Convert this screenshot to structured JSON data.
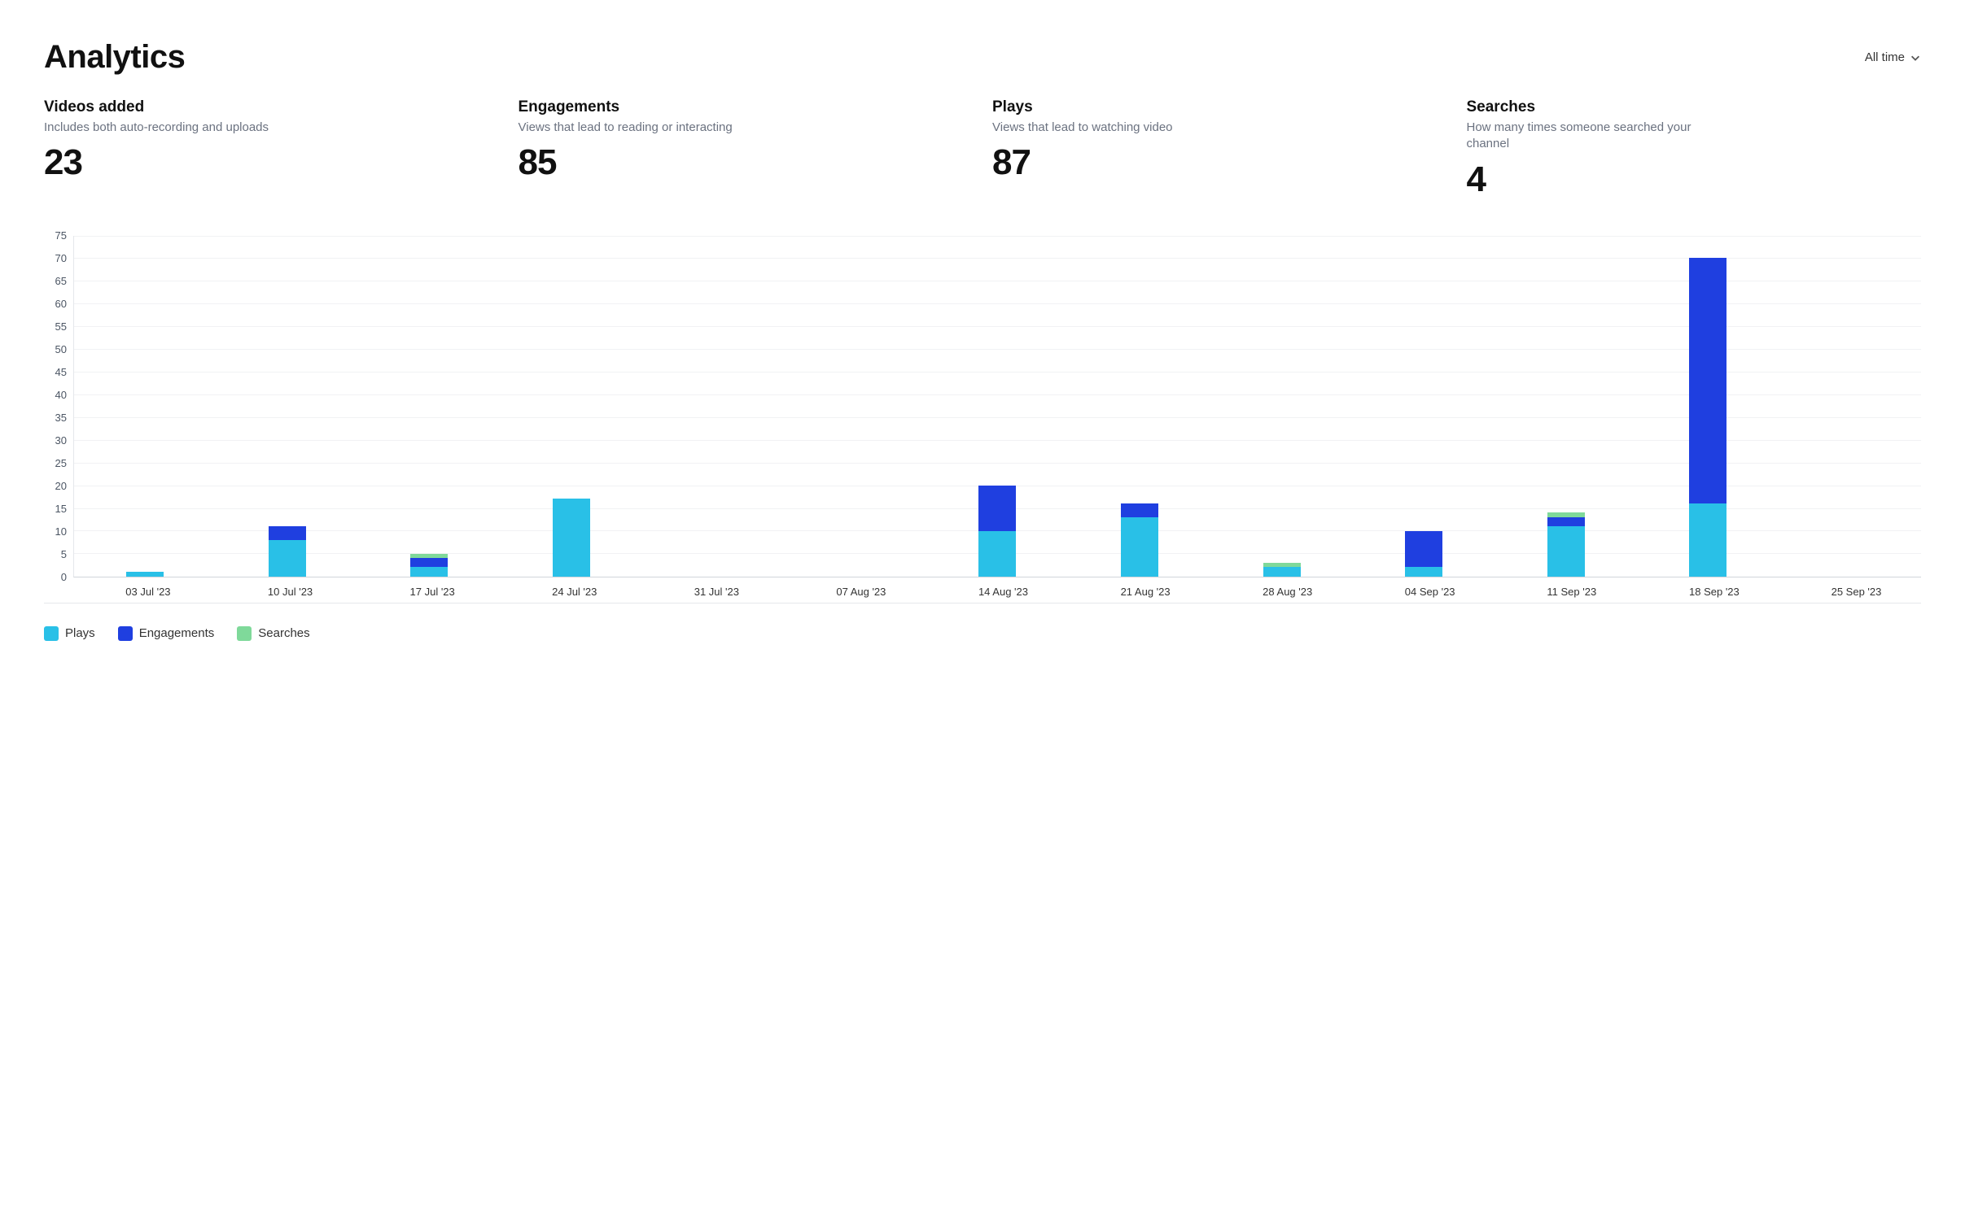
{
  "header": {
    "title": "Analytics",
    "time_range_label": "All time"
  },
  "stats": [
    {
      "title": "Videos added",
      "subtitle": "Includes both auto-recording and uploads",
      "value": "23"
    },
    {
      "title": "Engagements",
      "subtitle": "Views that lead to reading or interacting",
      "value": "85"
    },
    {
      "title": "Plays",
      "subtitle": "Views that lead to watching video",
      "value": "87"
    },
    {
      "title": "Searches",
      "subtitle": "How many times someone searched your channel",
      "value": "4"
    }
  ],
  "legend": {
    "plays": "Plays",
    "engagements": "Engagements",
    "searches": "Searches"
  },
  "colors": {
    "plays": "#29c0e7",
    "engagements": "#1f3fe0",
    "searches": "#7fd99a"
  },
  "chart_data": {
    "type": "bar",
    "stacked": true,
    "ylim": [
      0,
      75
    ],
    "y_ticks": [
      75,
      70,
      65,
      60,
      55,
      50,
      45,
      40,
      35,
      30,
      25,
      20,
      15,
      10,
      5,
      0
    ],
    "categories": [
      "03 Jul '23",
      "10 Jul '23",
      "17 Jul '23",
      "24 Jul '23",
      "31 Jul '23",
      "07 Aug '23",
      "14 Aug '23",
      "21 Aug '23",
      "28 Aug '23",
      "04 Sep '23",
      "11 Sep '23",
      "18 Sep '23",
      "25 Sep '23"
    ],
    "series": [
      {
        "name": "Plays",
        "values": [
          1,
          8,
          2,
          17,
          0,
          0,
          10,
          13,
          2,
          2,
          11,
          16,
          0
        ]
      },
      {
        "name": "Engagements",
        "values": [
          0,
          3,
          2,
          0,
          0,
          0,
          10,
          3,
          0,
          8,
          2,
          54,
          0
        ]
      },
      {
        "name": "Searches",
        "values": [
          0,
          0,
          1,
          0,
          0,
          0,
          0,
          0,
          1,
          0,
          1,
          0,
          0
        ]
      }
    ],
    "legend": [
      "Plays",
      "Engagements",
      "Searches"
    ],
    "title": "",
    "xlabel": "",
    "ylabel": ""
  }
}
